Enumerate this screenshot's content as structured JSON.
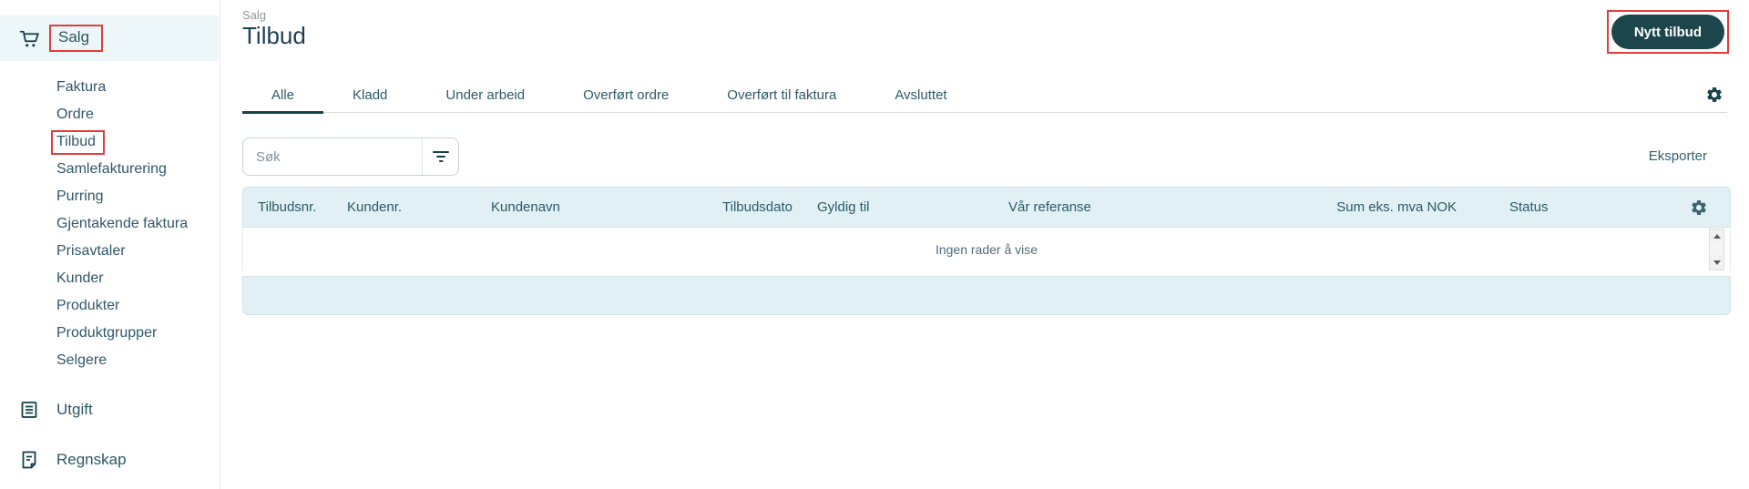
{
  "colors": {
    "accent_dark_teal": "#16434c",
    "button_background": "#1d464c",
    "light_blue_band": "#e1f0f4",
    "selected_row_background": "#edf6f8",
    "annotation_red": "#e23c3c"
  },
  "sidebar": {
    "salg": {
      "label": "Salg",
      "icon": "cart-icon"
    },
    "items": [
      {
        "label": "Faktura"
      },
      {
        "label": "Ordre"
      },
      {
        "label": "Tilbud"
      },
      {
        "label": "Samlefakturering"
      },
      {
        "label": "Purring"
      },
      {
        "label": "Gjentakende faktura"
      },
      {
        "label": "Prisavtaler"
      },
      {
        "label": "Kunder"
      },
      {
        "label": "Produkter"
      },
      {
        "label": "Produktgrupper"
      },
      {
        "label": "Selgere"
      }
    ],
    "utgift": {
      "label": "Utgift",
      "icon": "expense-document-icon"
    },
    "regnskap": {
      "label": "Regnskap",
      "icon": "ledger-icon"
    }
  },
  "header": {
    "breadcrumb": "Salg",
    "title": "Tilbud",
    "new_offer_button": "Nytt tilbud"
  },
  "tabs": [
    {
      "label": "Alle",
      "active": true
    },
    {
      "label": "Kladd",
      "active": false
    },
    {
      "label": "Under arbeid",
      "active": false
    },
    {
      "label": "Overført ordre",
      "active": false
    },
    {
      "label": "Overført til faktura",
      "active": false
    },
    {
      "label": "Avsluttet",
      "active": false
    }
  ],
  "toolbar": {
    "search_placeholder": "Søk",
    "export_label": "Eksporter"
  },
  "table": {
    "columns": [
      "Tilbudsnr.",
      "Kundenr.",
      "Kundenavn",
      "Tilbudsdato",
      "Gyldig til",
      "Vår referanse",
      "Sum eks. mva NOK",
      "Status"
    ],
    "empty_message": "Ingen rader å vise"
  }
}
